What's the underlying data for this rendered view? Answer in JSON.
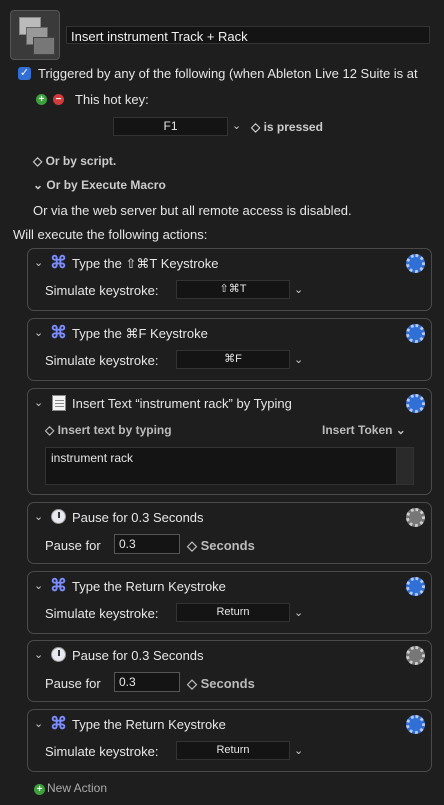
{
  "macro": {
    "name": "Insert instrument Track + Rack"
  },
  "trigger": {
    "checked_mark": "✓",
    "label": "Triggered by any of the following (when Ableton Live 12 Suite is at",
    "hotkey_label": "This hot key:",
    "hotkey_value": "F1",
    "hotkey_condition": "◇ is pressed",
    "or_script": "◇ Or by script.",
    "or_execute_macro": "⌄ Or by Execute Macro",
    "web_server_note": "Or via the web server but all remote access is disabled."
  },
  "actions_header": "Will execute the following actions:",
  "actions": [
    {
      "title": "Type the ⇧⌘T Keystroke",
      "label": "Simulate keystroke:",
      "value": "⇧⌘T"
    },
    {
      "title": "Type the ⌘F Keystroke",
      "label": "Simulate keystroke:",
      "value": "⌘F"
    },
    {
      "title": "Insert Text “instrument rack” by Typing",
      "mode": "◇ Insert text by typing",
      "token_menu": "Insert Token ⌄",
      "text": "instrument rack"
    },
    {
      "title": "Pause for 0.3 Seconds",
      "label": "Pause for",
      "value": "0.3",
      "unit": "◇ Seconds"
    },
    {
      "title": "Type the Return Keystroke",
      "label": "Simulate keystroke:",
      "value": "Return"
    },
    {
      "title": "Pause for 0.3 Seconds",
      "label": "Pause for",
      "value": "0.3",
      "unit": "◇ Seconds"
    },
    {
      "title": "Type the Return Keystroke",
      "label": "Simulate keystroke:",
      "value": "Return"
    }
  ],
  "new_action": "New Action",
  "icons": {
    "command": "⌘",
    "chevron_down": "⌄",
    "add": "+",
    "remove": "−"
  },
  "colors": {
    "accent_blue": "#2f6fd6",
    "add_green": "#3ea03e",
    "remove_red": "#d23b3b",
    "command_icon": "#7b8cff"
  }
}
